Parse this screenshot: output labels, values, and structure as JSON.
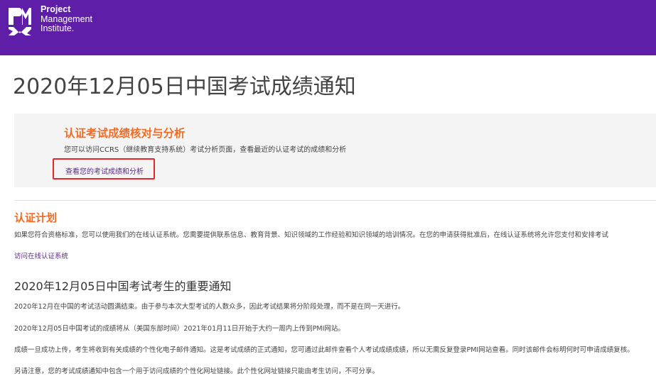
{
  "header": {
    "logo_line1": "Project",
    "logo_line2": "Management",
    "logo_line3": "Institute.",
    "bg_color": "#5f1ea8"
  },
  "page": {
    "title": "2020年12月05日中国考试成绩通知"
  },
  "card": {
    "title": "认证考试成绩核对与分析",
    "description": "您可以访问CCRS（继续教育支持系统）考试分析页面，查看最近的认证考试的成绩和分析",
    "link": "查看您的考试成绩和分析",
    "accent_color": "#f26b22",
    "highlight_color": "#e8262a"
  },
  "certification": {
    "title": "认证计划",
    "description": "如果您符合资格标准，您可以使用我们的在线认证系统。您需要提供联系信息、教育背景、知识领域的工作经验和知识领域的培训情况。在您的申请获得批准后，在线认证系统将允许您支付和安排考试",
    "link": "访问在线认证系统"
  },
  "notice": {
    "title": "2020年12月05日中国考试考生的重要通知",
    "paragraphs": [
      "2020年12月在中国的考试活动圆满结束。由于参与本次大型考试的人数众多，因此考试结果将分阶段处理，而不是在同一天进行。",
      "2020年12月05日中国考试的成绩将从（美国东部时间）2021年01月11日开始于大约一周内上传到PMI网站。",
      "成绩一旦成功上传，考生将收到有关成绩的个性化电子邮件通知。这是考试成绩的正式通知，您可通过此邮件查看个人考试成绩成绩，所以无需反复登录PMI网站查看。同时该邮件会标明何时可申请成绩复核。",
      "另请注意，您的考试成绩通知中包含一个用于访问成绩的个性化网址链接。此个性化网址链接只能由考生访问，不可分享。"
    ]
  }
}
